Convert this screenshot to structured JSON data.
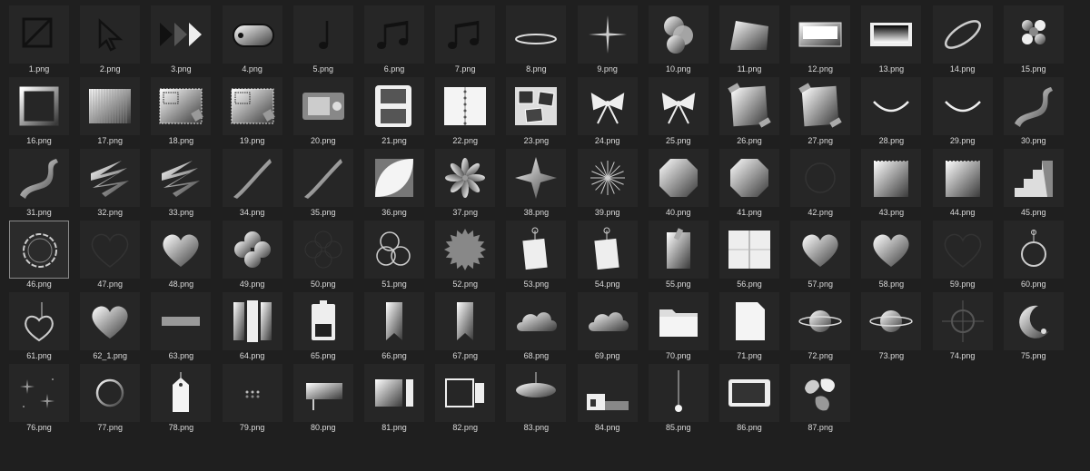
{
  "files": [
    {
      "name": "1.png",
      "icon": "slashed-square-icon"
    },
    {
      "name": "2.png",
      "icon": "cursor-arrow-icon"
    },
    {
      "name": "3.png",
      "icon": "triple-play-icon"
    },
    {
      "name": "4.png",
      "icon": "gradient-oval-icon"
    },
    {
      "name": "5.png",
      "icon": "quarter-note-icon"
    },
    {
      "name": "6.png",
      "icon": "beamed-notes-icon"
    },
    {
      "name": "7.png",
      "icon": "beamed-notes-icon"
    },
    {
      "name": "8.png",
      "icon": "ellipse-ring-icon"
    },
    {
      "name": "9.png",
      "icon": "sparkle-cross-icon"
    },
    {
      "name": "10.png",
      "icon": "overlap-circles-icon"
    },
    {
      "name": "11.png",
      "icon": "trapezoid-icon"
    },
    {
      "name": "12.png",
      "icon": "rectangle-panel-icon"
    },
    {
      "name": "13.png",
      "icon": "dark-panel-icon"
    },
    {
      "name": "14.png",
      "icon": "tilted-ring-icon"
    },
    {
      "name": "15.png",
      "icon": "four-spheres-icon"
    },
    {
      "name": "16.png",
      "icon": "square-frame-icon"
    },
    {
      "name": "17.png",
      "icon": "striped-panel-icon"
    },
    {
      "name": "18.png",
      "icon": "stamp-panel-icon"
    },
    {
      "name": "19.png",
      "icon": "stamp-panel-icon"
    },
    {
      "name": "20.png",
      "icon": "camera-device-icon"
    },
    {
      "name": "21.png",
      "icon": "handheld-console-icon"
    },
    {
      "name": "22.png",
      "icon": "open-notebook-icon"
    },
    {
      "name": "23.png",
      "icon": "photo-collage-icon"
    },
    {
      "name": "24.png",
      "icon": "ribbon-bow-icon"
    },
    {
      "name": "25.png",
      "icon": "ribbon-bow-icon"
    },
    {
      "name": "26.png",
      "icon": "taped-paper-icon"
    },
    {
      "name": "27.png",
      "icon": "taped-paper-icon"
    },
    {
      "name": "28.png",
      "icon": "arc-icon"
    },
    {
      "name": "29.png",
      "icon": "arc-icon"
    },
    {
      "name": "30.png",
      "icon": "wave-ribbon-icon"
    },
    {
      "name": "31.png",
      "icon": "wave-ribbon-icon"
    },
    {
      "name": "32.png",
      "icon": "zigzag-ribbon-icon"
    },
    {
      "name": "33.png",
      "icon": "zigzag-ribbon-icon"
    },
    {
      "name": "34.png",
      "icon": "diagonal-ribbon-icon"
    },
    {
      "name": "35.png",
      "icon": "diagonal-ribbon-icon"
    },
    {
      "name": "36.png",
      "icon": "leaf-square-icon"
    },
    {
      "name": "37.png",
      "icon": "flower-icon"
    },
    {
      "name": "38.png",
      "icon": "four-point-star-icon"
    },
    {
      "name": "39.png",
      "icon": "starburst-lines-icon"
    },
    {
      "name": "40.png",
      "icon": "octagon-icon"
    },
    {
      "name": "41.png",
      "icon": "octagon-icon"
    },
    {
      "name": "42.png",
      "icon": "circle-outline-icon"
    },
    {
      "name": "43.png",
      "icon": "note-paper-icon"
    },
    {
      "name": "44.png",
      "icon": "note-paper-icon"
    },
    {
      "name": "45.png",
      "icon": "stairs-icon"
    },
    {
      "name": "46.png",
      "icon": "scalloped-frame-icon"
    },
    {
      "name": "47.png",
      "icon": "heart-outline-icon"
    },
    {
      "name": "48.png",
      "icon": "heart-filled-icon"
    },
    {
      "name": "49.png",
      "icon": "clover-icon"
    },
    {
      "name": "50.png",
      "icon": "clover-outline-icon"
    },
    {
      "name": "51.png",
      "icon": "three-circles-icon"
    },
    {
      "name": "52.png",
      "icon": "burst-badge-icon"
    },
    {
      "name": "53.png",
      "icon": "hang-tag-icon"
    },
    {
      "name": "54.png",
      "icon": "hang-tag-icon"
    },
    {
      "name": "55.png",
      "icon": "clipped-card-icon"
    },
    {
      "name": "56.png",
      "icon": "folded-paper-icon"
    },
    {
      "name": "57.png",
      "icon": "heart-filled-icon"
    },
    {
      "name": "58.png",
      "icon": "heart-filled-icon"
    },
    {
      "name": "59.png",
      "icon": "heart-outline-icon"
    },
    {
      "name": "60.png",
      "icon": "ring-charm-icon"
    },
    {
      "name": "61.png",
      "icon": "heart-charm-icon"
    },
    {
      "name": "62_1.png",
      "icon": "heart-filled-icon"
    },
    {
      "name": "63.png",
      "icon": "bar-icon"
    },
    {
      "name": "64.png",
      "icon": "vertical-bars-icon"
    },
    {
      "name": "65.png",
      "icon": "battery-icon"
    },
    {
      "name": "66.png",
      "icon": "bookmark-icon"
    },
    {
      "name": "67.png",
      "icon": "bookmark-icon"
    },
    {
      "name": "68.png",
      "icon": "cloud-icon"
    },
    {
      "name": "69.png",
      "icon": "cloud-icon"
    },
    {
      "name": "70.png",
      "icon": "folder-icon"
    },
    {
      "name": "71.png",
      "icon": "page-icon"
    },
    {
      "name": "72.png",
      "icon": "planet-icon"
    },
    {
      "name": "73.png",
      "icon": "planet-icon"
    },
    {
      "name": "74.png",
      "icon": "crosshair-icon"
    },
    {
      "name": "75.png",
      "icon": "moon-icon"
    },
    {
      "name": "76.png",
      "icon": "sparkles-icon"
    },
    {
      "name": "77.png",
      "icon": "ring-icon"
    },
    {
      "name": "78.png",
      "icon": "price-tag-icon"
    },
    {
      "name": "79.png",
      "icon": "dots-icon"
    },
    {
      "name": "80.png",
      "icon": "sign-board-icon"
    },
    {
      "name": "81.png",
      "icon": "gradient-frame-icon"
    },
    {
      "name": "82.png",
      "icon": "outline-frame-icon"
    },
    {
      "name": "83.png",
      "icon": "hanging-lamp-icon"
    },
    {
      "name": "84.png",
      "icon": "shelf-icon"
    },
    {
      "name": "85.png",
      "icon": "pendulum-icon"
    },
    {
      "name": "86.png",
      "icon": "tablet-icon"
    },
    {
      "name": "87.png",
      "icon": "leaves-icon"
    }
  ],
  "selected_file": "46.png",
  "colors": {
    "background": "#1f1f1f",
    "tile": "#262626",
    "label": "#dcdcdc",
    "selection_border": "#8a8a8a"
  }
}
